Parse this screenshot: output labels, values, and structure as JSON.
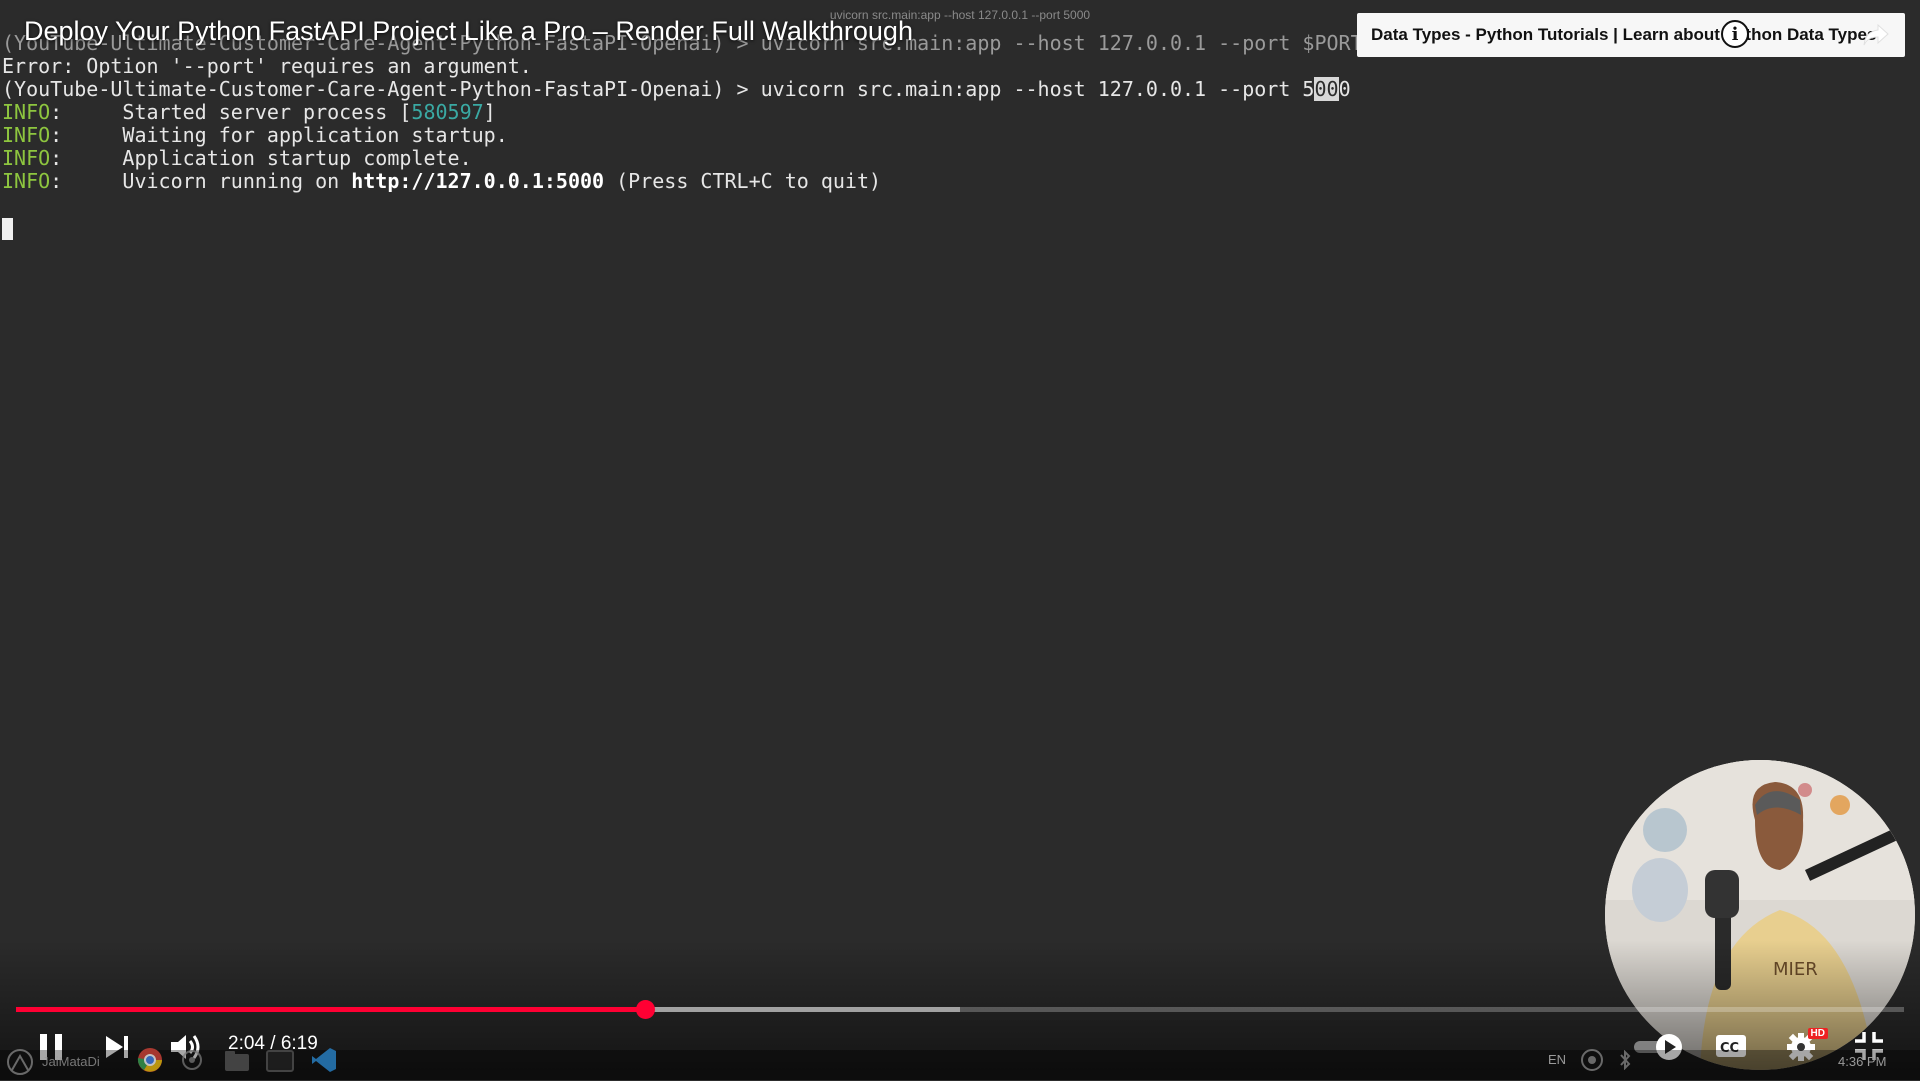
{
  "video": {
    "title": "Deploy Your Python FastAPI Project Like a Pro – Render Full Walkthrough",
    "current_time": "2:04",
    "duration": "6:19",
    "time_separator": " / ",
    "played_fraction": 0.333,
    "buffered_fraction": 0.5
  },
  "info_card": {
    "text": "Data Types - Python Tutorials | Learn about Python Data Types",
    "info_glyph": "i"
  },
  "terminal": {
    "window_title": "uvicorn src.main:app --host 127.0.0.1 --port 5000",
    "line1": "(YouTube-Ultimate-Customer-Care-Agent-Python-FastaPI-Openai) > uvicorn src.main:app --host 127.0.0.1 --port $PORT",
    "line2": "Error: Option '--port' requires an argument.",
    "line3_prefix": "(YouTube-Ultimate-Customer-Care-Agent-Python-FastaPI-Openai) > uvicorn src.main:app --host 127.0.0.1 --port 5",
    "line3_selected": "00",
    "line3_suffix": "0",
    "info_label": "INFO",
    "info_colon": ":",
    "line4_text": "     Started server process [",
    "line4_pid": "580597",
    "line4_end": "]",
    "line5_text": "     Waiting for application startup.",
    "line6_text": "     Application startup complete.",
    "line7_pre": "     Uvicorn running on ",
    "line7_url": "http://127.0.0.1:5000",
    "line7_post": " (Press CTRL+C to quit)"
  },
  "taskbar": {
    "user_label": "JaiMataDi",
    "lang": "EN",
    "clock": "4:36 PM"
  },
  "icons": {
    "pause": "pause-icon",
    "next": "next-icon",
    "volume": "volume-icon",
    "autoplay": "autoplay-toggle-icon",
    "captions": "cc-icon",
    "settings": "settings-gear-icon",
    "settings_badge": "HD",
    "fullscreen_exit": "exit-fullscreen-icon",
    "share": "share-icon",
    "info": "info-icon"
  },
  "colors": {
    "progress_played": "#ff0033",
    "hd_badge": "#e22",
    "info_green": "#8ec63f",
    "pid_teal": "#3aa9a3"
  }
}
